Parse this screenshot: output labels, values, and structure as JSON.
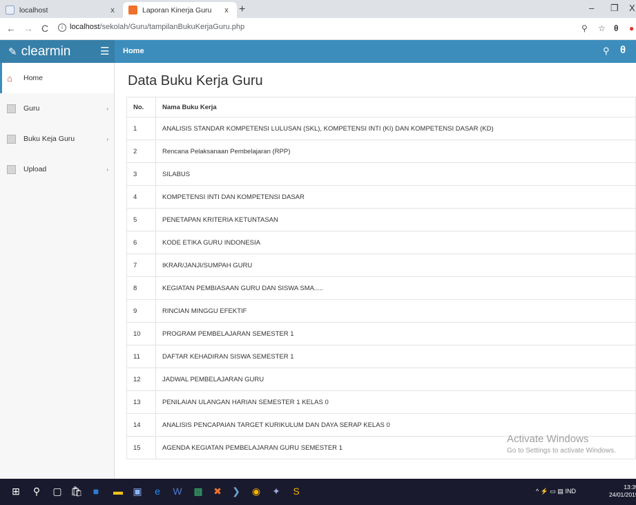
{
  "browser": {
    "tabs": [
      {
        "title": "localhost",
        "close": "x"
      },
      {
        "title": "Laporan Kinerja Guru",
        "close": "x"
      }
    ],
    "new_tab": "+",
    "window_controls": {
      "minimize": "–",
      "restore": "❐",
      "close": "X"
    },
    "nav": {
      "back": "←",
      "forward": "→",
      "reload": "C"
    },
    "url_host": "localhost",
    "url_path": "/sekolah/Guru/tampilanBukuKerjaGuru.php",
    "url_info": "i"
  },
  "app": {
    "brand": "clearmin",
    "breadcrumb": "Home",
    "accent_color": "#3c8dbc"
  },
  "sidebar": {
    "items": [
      {
        "label": "Home",
        "icon": "home-icon",
        "active": true
      },
      {
        "label": "Guru",
        "icon": "document-icon",
        "chevron": "›"
      },
      {
        "label": "Buku Keja Guru",
        "icon": "document-icon",
        "chevron": "›"
      },
      {
        "label": "Upload",
        "icon": "document-icon",
        "chevron": "›"
      }
    ]
  },
  "main": {
    "title": "Data Buku Kerja Guru",
    "columns": [
      "No.",
      "Nama Buku Kerja"
    ],
    "rows": [
      {
        "no": "1",
        "name": "ANALISIS STANDAR KOMPETENSI LULUSAN (SKL), KOMPETENSI INTI (KI) DAN KOMPETENSI DASAR (KD)"
      },
      {
        "no": "2",
        "name": "Rencana Pelaksanaan Pembelajaran (RPP)"
      },
      {
        "no": "3",
        "name": "SILABUS"
      },
      {
        "no": "4",
        "name": "KOMPETENSI INTI DAN KOMPETENSI DASAR"
      },
      {
        "no": "5",
        "name": "PENETAPAN KRITERIA KETUNTASAN"
      },
      {
        "no": "6",
        "name": "KODE ETIKA GURU INDONESIA"
      },
      {
        "no": "7",
        "name": "IKRAR/JANJI/SUMPAH GURU"
      },
      {
        "no": "8",
        "name": "KEGIATAN PEMBIASAAN GURU DAN SISWA SMA....."
      },
      {
        "no": "9",
        "name": "RINCIAN MINGGU EFEKTIF"
      },
      {
        "no": "10",
        "name": "PROGRAM PEMBELAJARAN SEMESTER 1"
      },
      {
        "no": "11",
        "name": "DAFTAR KEHADIRAN SISWA SEMESTER 1"
      },
      {
        "no": "12",
        "name": "JADWAL PEMBELAJARAN GURU"
      },
      {
        "no": "13",
        "name": "PENILAIAN ULANGAN HARIAN SEMESTER 1 KELAS 0"
      },
      {
        "no": "14",
        "name": "ANALISIS PENCAPAIAN TARGET KURIKULUM DAN DAYA SERAP KELAS 0"
      },
      {
        "no": "15",
        "name": "AGENDA KEGIATAN PEMBELAJARAN GURU SEMESTER 1"
      }
    ]
  },
  "watermark": {
    "line1": "Activate Windows",
    "line2": "Go to Settings to activate Windows."
  },
  "taskbar": {
    "tray_text": "^ ⚡ ▭ ▤ IND",
    "time": "13:39",
    "date": "24/01/2019"
  }
}
